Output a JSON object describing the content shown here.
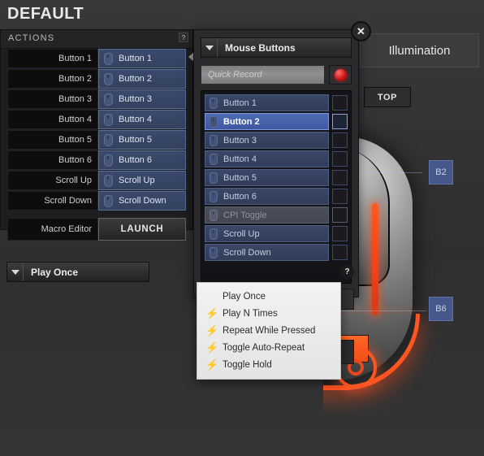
{
  "page_title": "DEFAULT",
  "actions_panel": {
    "header": "ACTIONS",
    "help": "?",
    "rows": [
      {
        "label": "Button 1",
        "assignment": "Button 1"
      },
      {
        "label": "Button 2",
        "assignment": "Button 2"
      },
      {
        "label": "Button 3",
        "assignment": "Button 3"
      },
      {
        "label": "Button 4",
        "assignment": "Button 4"
      },
      {
        "label": "Button 5",
        "assignment": "Button 5"
      },
      {
        "label": "Button 6",
        "assignment": "Button 6"
      },
      {
        "label": "Scroll Up",
        "assignment": "Scroll Up"
      },
      {
        "label": "Scroll Down",
        "assignment": "Scroll Down"
      }
    ],
    "macro_editor_label": "Macro Editor",
    "launch_button": "LAUNCH"
  },
  "illumination": {
    "tab_label": "Illumination",
    "top_button": "TOP"
  },
  "mouse_preview": {
    "callout_b2": "B2",
    "callout_b6": "B6"
  },
  "dialog": {
    "close": "✕",
    "category_dropdown": "Mouse Buttons",
    "quick_record_placeholder": "Quick Record",
    "record_button_name": "record",
    "list": [
      {
        "label": "Button 1",
        "state": "normal",
        "checked": false
      },
      {
        "label": "Button 2",
        "state": "selected",
        "checked": false
      },
      {
        "label": "Button 3",
        "state": "normal",
        "checked": false
      },
      {
        "label": "Button 4",
        "state": "normal",
        "checked": false
      },
      {
        "label": "Button 5",
        "state": "normal",
        "checked": false
      },
      {
        "label": "Button 6",
        "state": "normal",
        "checked": false
      },
      {
        "label": "CPI Toggle",
        "state": "disabled",
        "checked": false
      },
      {
        "label": "Scroll Up",
        "state": "normal",
        "checked": false
      },
      {
        "label": "Scroll Down",
        "state": "normal",
        "checked": false
      }
    ],
    "playback_dropdown": "Play Once",
    "playback_help": "?",
    "playback_menu": [
      {
        "label": "Play Once",
        "icon": false
      },
      {
        "label": "Play N Times",
        "icon": true
      },
      {
        "label": "Repeat While Pressed",
        "icon": true
      },
      {
        "label": "Toggle Auto-Repeat",
        "icon": true
      },
      {
        "label": "Toggle Hold",
        "icon": true
      }
    ]
  },
  "colors": {
    "background": "#343434",
    "panel_dark": "#1e1e20",
    "row_blue": "#34425f",
    "row_blue_selected": "#4e6bb4",
    "accent_orange": "#ff5522",
    "record_red": "#d01414",
    "menu_light": "#f2f2f2"
  }
}
